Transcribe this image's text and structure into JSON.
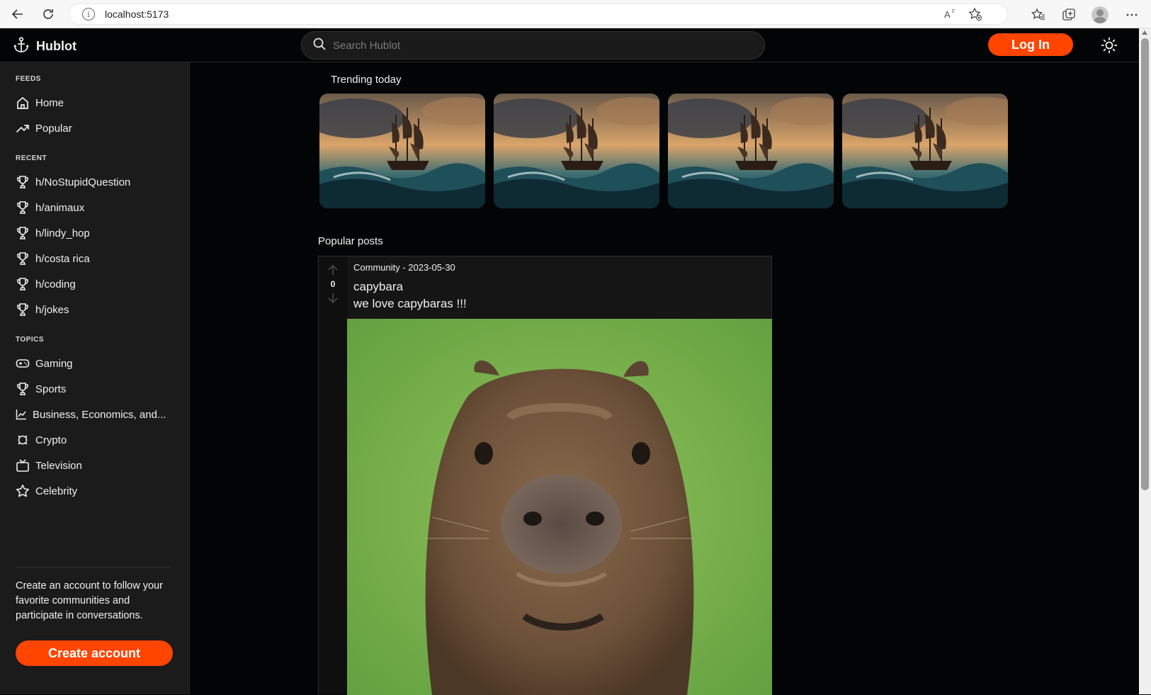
{
  "browser": {
    "url": "localhost:5173",
    "icons": [
      "back-arrow-icon",
      "refresh-icon",
      "info-icon",
      "read-aloud-icon",
      "add-favorite-icon",
      "favorites-icon",
      "collections-icon",
      "profile-icon",
      "more-icon"
    ]
  },
  "header": {
    "logo_text": "Hublot",
    "search_placeholder": "Search Hublot",
    "login_label": "Log In"
  },
  "sidebar": {
    "feeds_title": "FEEDS",
    "feeds": [
      {
        "label": "Home",
        "icon": "home-icon"
      },
      {
        "label": "Popular",
        "icon": "trending-icon"
      }
    ],
    "recent_title": "RECENT",
    "recent": [
      {
        "label": "h/NoStupidQuestion",
        "icon": "trophy-icon"
      },
      {
        "label": "h/animaux",
        "icon": "trophy-icon"
      },
      {
        "label": "h/lindy_hop",
        "icon": "trophy-icon"
      },
      {
        "label": "h/costa rica",
        "icon": "trophy-icon"
      },
      {
        "label": "h/coding",
        "icon": "trophy-icon"
      },
      {
        "label": "h/jokes",
        "icon": "trophy-icon"
      }
    ],
    "topics_title": "TOPICS",
    "topics": [
      {
        "label": "Gaming",
        "icon": "gamepad-icon"
      },
      {
        "label": "Sports",
        "icon": "trophy-icon"
      },
      {
        "label": "Business, Economics, and...",
        "icon": "chart-icon"
      },
      {
        "label": "Crypto",
        "icon": "crypto-icon"
      },
      {
        "label": "Television",
        "icon": "tv-icon"
      },
      {
        "label": "Celebrity",
        "icon": "star-icon"
      }
    ],
    "promo_text": "Create an account to follow your favorite communities and participate in conversations.",
    "create_account_label": "Create account"
  },
  "main": {
    "trending_title": "Trending today",
    "trending_count": 4,
    "popular_title": "Popular posts",
    "post": {
      "meta": "Community - 2023-05-30",
      "votes": "0",
      "title": "capybara",
      "body": "we love capybaras !!!"
    }
  },
  "colors": {
    "accent": "#ff4500",
    "background": "#030405",
    "sidebar": "#1b1b1b"
  }
}
